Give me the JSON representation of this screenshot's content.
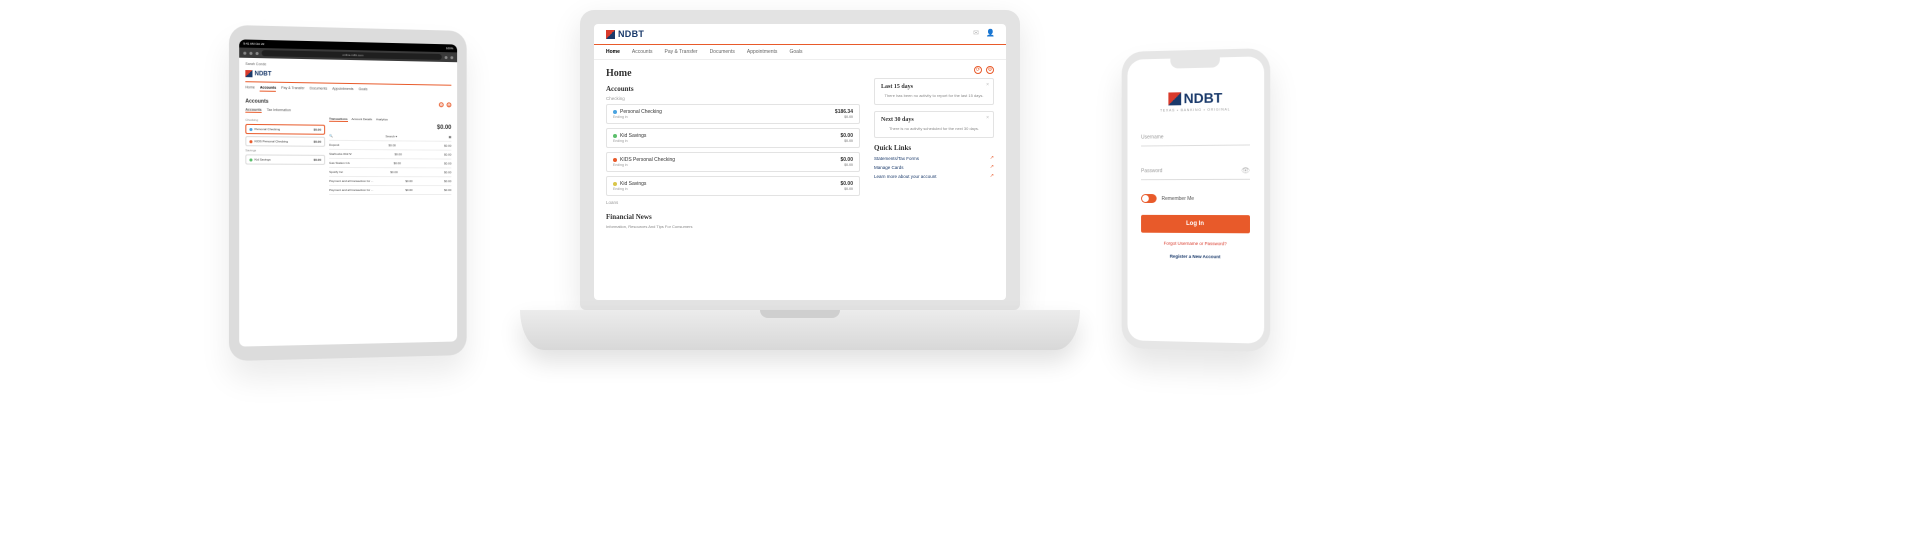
{
  "brand": {
    "name": "NDBT",
    "tagline": "TEXAS • BANKING • ORIGINAL"
  },
  "colors": {
    "accent": "#e85a2a",
    "navy": "#1a3a6b",
    "red": "#d93a2b"
  },
  "tablet": {
    "status": {
      "time": "9:41 AM Oct 22",
      "right": "100%"
    },
    "url": "online.ndbt.com",
    "welcome": "Sarah Conde",
    "nav": [
      "Home",
      "Accounts",
      "Pay & Transfer",
      "Documents",
      "Appointments",
      "Goals"
    ],
    "active_nav": "Accounts",
    "title": "Accounts",
    "subnav": [
      "Accounts",
      "Tax Information"
    ],
    "left": {
      "section_checking": "Checking",
      "accounts_checking": [
        {
          "name": "Personal Checking",
          "color": "#4aa3e0",
          "amount": "$0.00",
          "selected": true
        },
        {
          "name": "KIDS Personal Checking",
          "color": "#e85a2a",
          "amount": "$0.00"
        }
      ],
      "section_savings": "Savings",
      "accounts_savings": [
        {
          "name": "Kid Savings",
          "color": "#5bbf6b",
          "amount": "$0.00"
        }
      ]
    },
    "right": {
      "tabs": [
        "Transactions",
        "Account Details",
        "Analytics"
      ],
      "active_tab": "Transactions",
      "balance": "$0.00",
      "rows": [
        {
          "desc": "Deposit",
          "amt": "$0.00",
          "bal": "$0.00"
        },
        {
          "desc": "Starbucks #4172",
          "amt": "$0.00",
          "bal": "$0.00"
        },
        {
          "desc": "Gas Station CA",
          "amt": "$0.00",
          "bal": "$0.00"
        },
        {
          "desc": "Spotify Inc",
          "amt": "$0.00",
          "bal": "$0.00"
        },
        {
          "desc": "Payment and all transaction for ...",
          "amt": "$0.00",
          "bal": "$0.00"
        },
        {
          "desc": "Payment and all transaction for ...",
          "amt": "$0.00",
          "bal": "$0.00"
        }
      ]
    }
  },
  "laptop": {
    "nav": [
      "Home",
      "Accounts",
      "Pay & Transfer",
      "Documents",
      "Appointments",
      "Goals"
    ],
    "active_nav": "Home",
    "title": "Home",
    "accounts_heading": "Accounts",
    "section_checking": "Checking",
    "accounts": [
      {
        "name": "Personal Checking",
        "sub": "Ending in",
        "color": "#4aa3e0",
        "amount": "$186.34",
        "amount_sub": "$0.00"
      },
      {
        "name": "Kid Savings",
        "sub": "Ending in",
        "color": "#5bbf6b",
        "amount": "$0.00",
        "amount_sub": "$0.00"
      },
      {
        "name": "KIDS Personal Checking",
        "sub": "Ending in",
        "color": "#e85a2a",
        "amount": "$0.00",
        "amount_sub": "$0.00"
      },
      {
        "name": "Kid Savings",
        "sub": "Ending in",
        "color": "#d9c64a",
        "amount": "$0.00",
        "amount_sub": "$0.00"
      }
    ],
    "section_loans": "Loans",
    "financial_news": "Financial News",
    "financial_sub": "Information, Resources And Tips For Consumers",
    "side": {
      "last15_title": "Last 15 days",
      "last15_msg": "There has been no activity to report for the last 15 days.",
      "next30_title": "Next 30 days",
      "next30_msg": "There is no activity scheduled for the next 30 days.",
      "ql_title": "Quick Links",
      "ql": [
        "Statements/Tax Forms",
        "Manage Cards",
        "Learn more about your account"
      ]
    }
  },
  "phone": {
    "username_placeholder": "Username",
    "password_placeholder": "Password",
    "remember": "Remember Me",
    "login": "Log In",
    "forgot": "Forgot Username or Password?",
    "register": "Register a New Account"
  }
}
